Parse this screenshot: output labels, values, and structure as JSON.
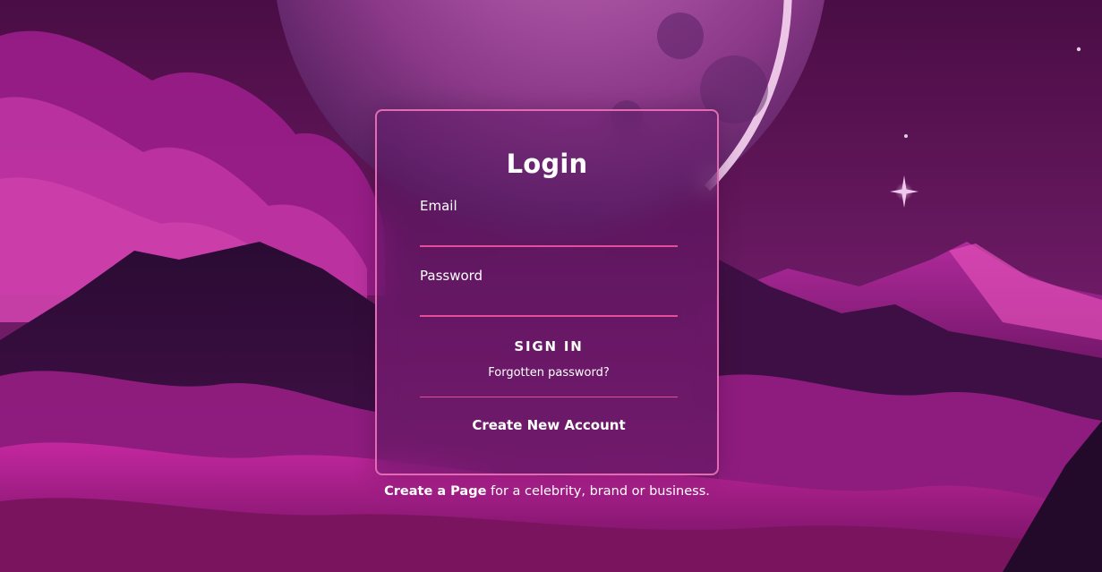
{
  "login": {
    "title": "Login",
    "email_label": "Email",
    "email_value": "",
    "password_label": "Password",
    "password_value": "",
    "signin_label": "SIGN IN",
    "forgot_label": "Forgotten password?",
    "create_account_label": "Create New Account"
  },
  "footer": {
    "link_label": "Create a Page",
    "suffix_text": " for a celebrity, brand or business."
  },
  "colors": {
    "accent": "#e44d9a",
    "card_border": "#e46ab4",
    "text": "#ffffff",
    "sky": "#5a1250"
  },
  "icons": [
    "moon-illustration",
    "sparkle-star"
  ]
}
